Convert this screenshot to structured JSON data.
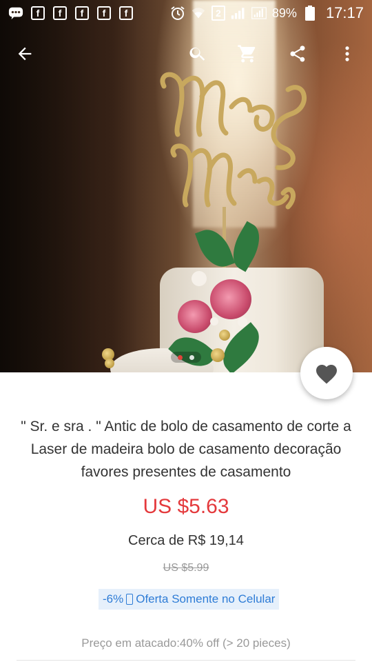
{
  "status_bar": {
    "sim_slot": "2",
    "battery_percent": "89%",
    "time": "17:17",
    "notification_icons": [
      "messenger-icon",
      "facebook-icon",
      "facebook-icon",
      "facebook-icon",
      "facebook-icon",
      "facebook-icon",
      "alarm-icon",
      "wifi-icon"
    ],
    "fb_glyph": "f"
  },
  "toolbar": {
    "icons": [
      "back-arrow-icon",
      "search-icon",
      "cart-icon",
      "share-icon",
      "more-vert-icon"
    ]
  },
  "gallery": {
    "page_count": 2,
    "active_page": 1
  },
  "product": {
    "title": "\" Sr. e sra . \" Antic de bolo de casamento de corte a Laser de madeira bolo de casamento decoração favores presentes de casamento",
    "price": "US $5.63",
    "local_price": "Cerca de R$ 19,14",
    "original_price": "US $5.99",
    "promo_discount": "-6%",
    "promo_label": "Oferta Somente no Celular",
    "wholesale": "Preço em atacado:40% off (> 20 pieces)"
  },
  "colors": {
    "price": "#e4393c",
    "promo_text": "#2e7cd6",
    "promo_bg": "#e6f0fb"
  }
}
